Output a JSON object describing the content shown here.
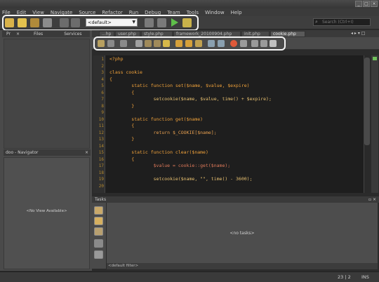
{
  "menu": [
    "File",
    "Edit",
    "View",
    "Navigate",
    "Source",
    "Refactor",
    "Run",
    "Debug",
    "Team",
    "Tools",
    "Window",
    "Help"
  ],
  "toolbar": {
    "config_value": "<default>",
    "search_placeholder": "Search (Ctrl+I)"
  },
  "left_panel": {
    "tabs": [
      "Pr",
      "Files",
      "Services"
    ],
    "navigator_title": "doo - Navigator",
    "navigator_empty": "<No View Available>"
  },
  "editor": {
    "tabs": [
      "...hp",
      "user.php",
      "style.php",
      "framework_20100904.php",
      "init.php",
      "cookie.php"
    ],
    "lines": [
      "<?php",
      "",
      "class cookie",
      "{",
      "        static function set($name, $value, $expire)",
      "        {",
      "                setcookie($name, $value, time() + $expire);",
      "        }",
      "",
      "        static function get($name)",
      "        {",
      "                return $_COOKIE[$name];",
      "        }",
      "",
      "        static function clear($name)",
      "        {",
      "                $value = cookie::get($name);",
      "",
      "                setcookie($name, \"\", time() - 3600);",
      ""
    ]
  },
  "tasks": {
    "title": "Tasks",
    "empty": "<no tasks>",
    "filter": "<default filter>"
  },
  "status": {
    "position": "23 | 2",
    "mode": "INS"
  }
}
